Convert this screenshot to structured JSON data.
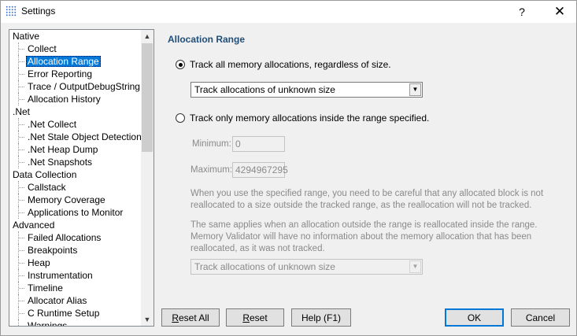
{
  "window": {
    "title": "Settings",
    "help_glyph": "?",
    "close_glyph": "✕"
  },
  "tree": {
    "nodes": [
      {
        "label": "Native",
        "kind": "cat"
      },
      {
        "label": "Collect",
        "kind": "child"
      },
      {
        "label": "Allocation Range",
        "kind": "child",
        "selected": true
      },
      {
        "label": "Error Reporting",
        "kind": "child"
      },
      {
        "label": "Trace / OutputDebugString",
        "kind": "child"
      },
      {
        "label": "Allocation History",
        "kind": "child"
      },
      {
        "label": ".Net",
        "kind": "cat"
      },
      {
        "label": ".Net Collect",
        "kind": "child"
      },
      {
        "label": ".Net Stale Object Detection",
        "kind": "child"
      },
      {
        "label": ".Net Heap Dump",
        "kind": "child"
      },
      {
        "label": ".Net Snapshots",
        "kind": "child"
      },
      {
        "label": "Data Collection",
        "kind": "cat"
      },
      {
        "label": "Callstack",
        "kind": "child"
      },
      {
        "label": "Memory Coverage",
        "kind": "child"
      },
      {
        "label": "Applications to Monitor",
        "kind": "child"
      },
      {
        "label": "Advanced",
        "kind": "cat"
      },
      {
        "label": "Failed Allocations",
        "kind": "child"
      },
      {
        "label": "Breakpoints",
        "kind": "child"
      },
      {
        "label": "Heap",
        "kind": "child"
      },
      {
        "label": "Instrumentation",
        "kind": "child"
      },
      {
        "label": "Timeline",
        "kind": "child"
      },
      {
        "label": "Allocator Alias",
        "kind": "child"
      },
      {
        "label": "C Runtime Setup",
        "kind": "child"
      },
      {
        "label": "Warnings",
        "kind": "child"
      }
    ]
  },
  "panel": {
    "heading": "Allocation Range",
    "radio_all": {
      "label": "Track all memory allocations, regardless of size.",
      "checked": true
    },
    "combo_top": {
      "value": "Track allocations of unknown size"
    },
    "radio_range": {
      "label": "Track only memory allocations inside the range specified.",
      "checked": false
    },
    "minimum": {
      "label": "Minimum:",
      "value": "0"
    },
    "maximum": {
      "label": "Maximum:",
      "value": "4294967295"
    },
    "note1": "When you use the specified range, you need to be careful that any allocated block is not reallocated to a size outside the tracked range, as the reallocation will not be tracked.",
    "note2": "The same applies when an allocation outside the range is reallocated inside the range. Memory Validator will have no information about the memory allocation that has been reallocated, as it was not tracked.",
    "combo_bottom": {
      "value": "Track allocations of unknown size"
    }
  },
  "buttons": {
    "reset_all": {
      "pre": "",
      "key": "R",
      "post": "eset All"
    },
    "reset": {
      "pre": "",
      "key": "R",
      "post": "eset"
    },
    "help": {
      "label": "Help (F1)"
    },
    "ok": {
      "label": "OK"
    },
    "cancel": {
      "label": "Cancel"
    }
  },
  "icons": {
    "scroll_up": "▲",
    "scroll_down": "▼",
    "dropdown": "▼"
  }
}
